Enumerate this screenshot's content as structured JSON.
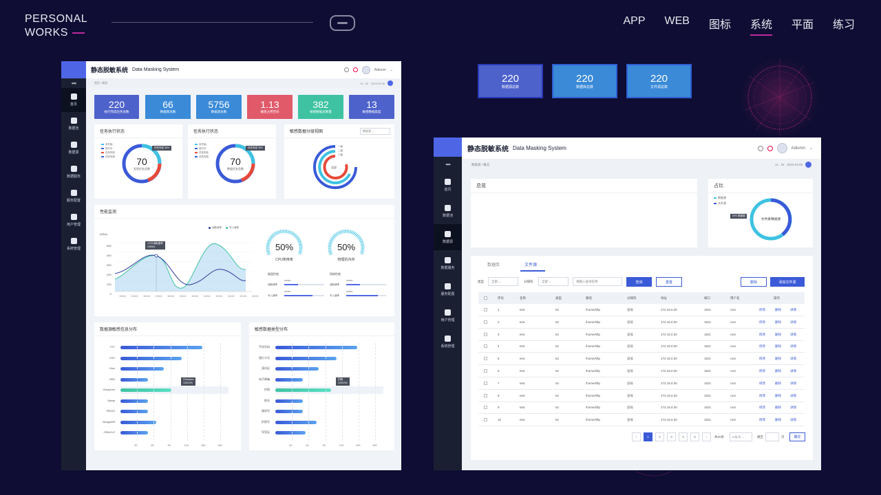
{
  "brand": {
    "line1": "PERSONAL",
    "line2": "WORKS"
  },
  "nav": [
    "APP",
    "WEB",
    "图标",
    "系统",
    "平面",
    "练习"
  ],
  "common": {
    "app_title": "静态脱敏系统",
    "app_subtitle": "Data Masking System",
    "user": "Adionm",
    "time": "11 : 32",
    "date": "2019.03.08"
  },
  "w1": {
    "breadcrumb": [
      "首页",
      "/",
      "概览"
    ],
    "sidebar": [
      "首页",
      "数据池",
      "数据源",
      "数据服务",
      "服务配置",
      "用户管理",
      "系统管理"
    ],
    "stats": [
      {
        "value": "220",
        "label": "执行完成任务总数",
        "color": "#4e62cc"
      },
      {
        "value": "66",
        "label": "数据库总数",
        "color": "#3a8ad8"
      },
      {
        "value": "5756",
        "label": "数据源总数",
        "color": "#3a8ad8"
      },
      {
        "value": "1.13",
        "label": "磁盘占用空间",
        "color": "#e05a6a"
      },
      {
        "value": "382",
        "label": "敏感数据总数量",
        "color": "#3ec2a2"
      },
      {
        "value": "13",
        "label": "敏感数据类型",
        "color": "#4e62cc"
      }
    ],
    "card1": {
      "title": "任务执行状态",
      "legend": [
        "未开始",
        "进行中",
        "任务失败",
        "任务完成"
      ],
      "value": "70",
      "sub": "发现任务总数",
      "tip": "任务完成",
      "tip_pct": "35%"
    },
    "card2": {
      "title": "任务执行状态",
      "legend": [
        "未开始",
        "进行中",
        "任务失败",
        "任务完成"
      ],
      "value": "70",
      "sub": "数据任务总数",
      "tip": "任务完成",
      "tip_pct": "35%"
    },
    "card3": {
      "title": "敏感数据分级视图",
      "select": "数据源",
      "legend": [
        "一级",
        "二级",
        "三级"
      ],
      "center": "全部"
    },
    "perf": {
      "title": "性能监测",
      "legend": [
        "读取速率",
        "写入速率"
      ],
      "ylabel": "(KB/s)",
      "yticks": [
        "500",
        "400",
        "300",
        "200",
        "100",
        "0"
      ],
      "xticks": [
        "13:01",
        "13:01",
        "13:01",
        "13:01",
        "13:01",
        "13:01",
        "13:01",
        "13:01",
        "13:01",
        "13:01",
        "13:01",
        "13:01",
        "13:01"
      ],
      "tip1": "13:01读取速率",
      "tip2": "10KB/s",
      "cpu": {
        "value": "50%",
        "label": "CPU使用率"
      },
      "mem": {
        "value": "50%",
        "label": "物理机内存"
      },
      "disk_title": "磁盘性能",
      "net_title": "网络性能",
      "disk_read": "读取速率",
      "disk_write": "写入速率",
      "net_read": "读取速率",
      "net_write": "写入速率",
      "speed": "10KB/s"
    },
    "dist1": {
      "title": "数据源敏感信息分布",
      "labels": [
        "TXT",
        "CSV",
        "Hive",
        "DB2",
        "Greeplum",
        "Mysql",
        "REDIS",
        "MongoDB",
        "ORACLE"
      ],
      "values": [
        148,
        110,
        78,
        50,
        92,
        50,
        50,
        65,
        50
      ],
      "xticks": [
        "30",
        "60",
        "90",
        "120",
        "150",
        "180"
      ],
      "tip1": "Greeplum",
      "tip2": "120/10%"
    },
    "dist2": {
      "title": "敏感数据类型分布",
      "labels": [
        "手机号码",
        "银行卡号",
        "身份证",
        "电子邮箱",
        "护照",
        "姓名",
        "座机号",
        "护照号",
        "军官证"
      ],
      "values": [
        148,
        110,
        78,
        50,
        100,
        50,
        50,
        75,
        55
      ],
      "xticks": [
        "30",
        "60",
        "90",
        "120",
        "150",
        "180"
      ],
      "tip1": "护照",
      "tip2": "120/10%"
    }
  },
  "w2": {
    "breadcrumb": [
      "数据源",
      "/",
      "概览"
    ],
    "sidebar": [
      "首页",
      "数据池",
      "数据源",
      "数据服务",
      "服务配置",
      "用户管理",
      "系统管理"
    ],
    "overview": {
      "title": "总览",
      "boxes": [
        {
          "value": "220",
          "label": "数据源总数",
          "color": "#4e62cc"
        },
        {
          "value": "220",
          "label": "数据库总数",
          "color": "#3a8ad8"
        },
        {
          "value": "220",
          "label": "文件源总数",
          "color": "#3a8ad8"
        }
      ]
    },
    "ratio": {
      "title": "占比",
      "legend": [
        "数据源",
        "文件源"
      ],
      "center": "文件源/数据源",
      "tip": "60% 数据源"
    },
    "tabs": [
      "数据库",
      "文件源"
    ],
    "filters": {
      "type_label": "类型",
      "type_value": "全部",
      "sep_label": "分隔符",
      "sep_value": "全部",
      "search_placeholder": "请输入查询名称",
      "query": "查询",
      "reset": "重置",
      "delete": "删除",
      "add": "添加文件源"
    },
    "columns": [
      "序号",
      "名称",
      "类型",
      "路径",
      "分隔符",
      "地址",
      "端口",
      "用户名",
      "操作"
    ],
    "rows": [
      {
        "no": "1",
        "name": "test",
        "type": "txt",
        "path": "/home/sftp",
        "sep": "逗号",
        "addr": "172.16.0.30",
        "port": "1521",
        "user": "root"
      },
      {
        "no": "2",
        "name": "test",
        "type": "txt",
        "path": "/home/sftp",
        "sep": "逗号",
        "addr": "172.16.0.30",
        "port": "1521",
        "user": "root"
      },
      {
        "no": "3",
        "name": "test",
        "type": "txt",
        "path": "/home/sftp",
        "sep": "逗号",
        "addr": "172.16.0.30",
        "port": "1521",
        "user": "root"
      },
      {
        "no": "4",
        "name": "test",
        "type": "txt",
        "path": "/home/sftp",
        "sep": "逗号",
        "addr": "172.16.0.30",
        "port": "1521",
        "user": "root"
      },
      {
        "no": "5",
        "name": "test",
        "type": "txt",
        "path": "/home/sftp",
        "sep": "逗号",
        "addr": "172.16.0.30",
        "port": "1521",
        "user": "root"
      },
      {
        "no": "6",
        "name": "test",
        "type": "txt",
        "path": "/home/sftp",
        "sep": "逗号",
        "addr": "172.16.0.30",
        "port": "1521",
        "user": "root"
      },
      {
        "no": "7",
        "name": "test",
        "type": "txt",
        "path": "/home/sftp",
        "sep": "逗号",
        "addr": "172.16.0.30",
        "port": "1521",
        "user": "root"
      },
      {
        "no": "8",
        "name": "test",
        "type": "txt",
        "path": "/home/sftp",
        "sep": "逗号",
        "addr": "172.16.0.30",
        "port": "1521",
        "user": "root"
      },
      {
        "no": "9",
        "name": "test",
        "type": "txt",
        "path": "/home/sftp",
        "sep": "逗号",
        "addr": "172.16.0.30",
        "port": "1521",
        "user": "root"
      },
      {
        "no": "10",
        "name": "test",
        "type": "txt",
        "path": "/home/sftp",
        "sep": "逗号",
        "addr": "172.16.0.30",
        "port": "1521",
        "user": "root"
      }
    ],
    "actions": [
      "修改",
      "删除",
      "详情"
    ],
    "pagination": {
      "pages": [
        "1",
        "2",
        "3",
        "4",
        "5"
      ],
      "total": "共20条",
      "per_page": "10条/页",
      "jump": "跳至",
      "unit": "页",
      "confirm": "确定"
    }
  }
}
